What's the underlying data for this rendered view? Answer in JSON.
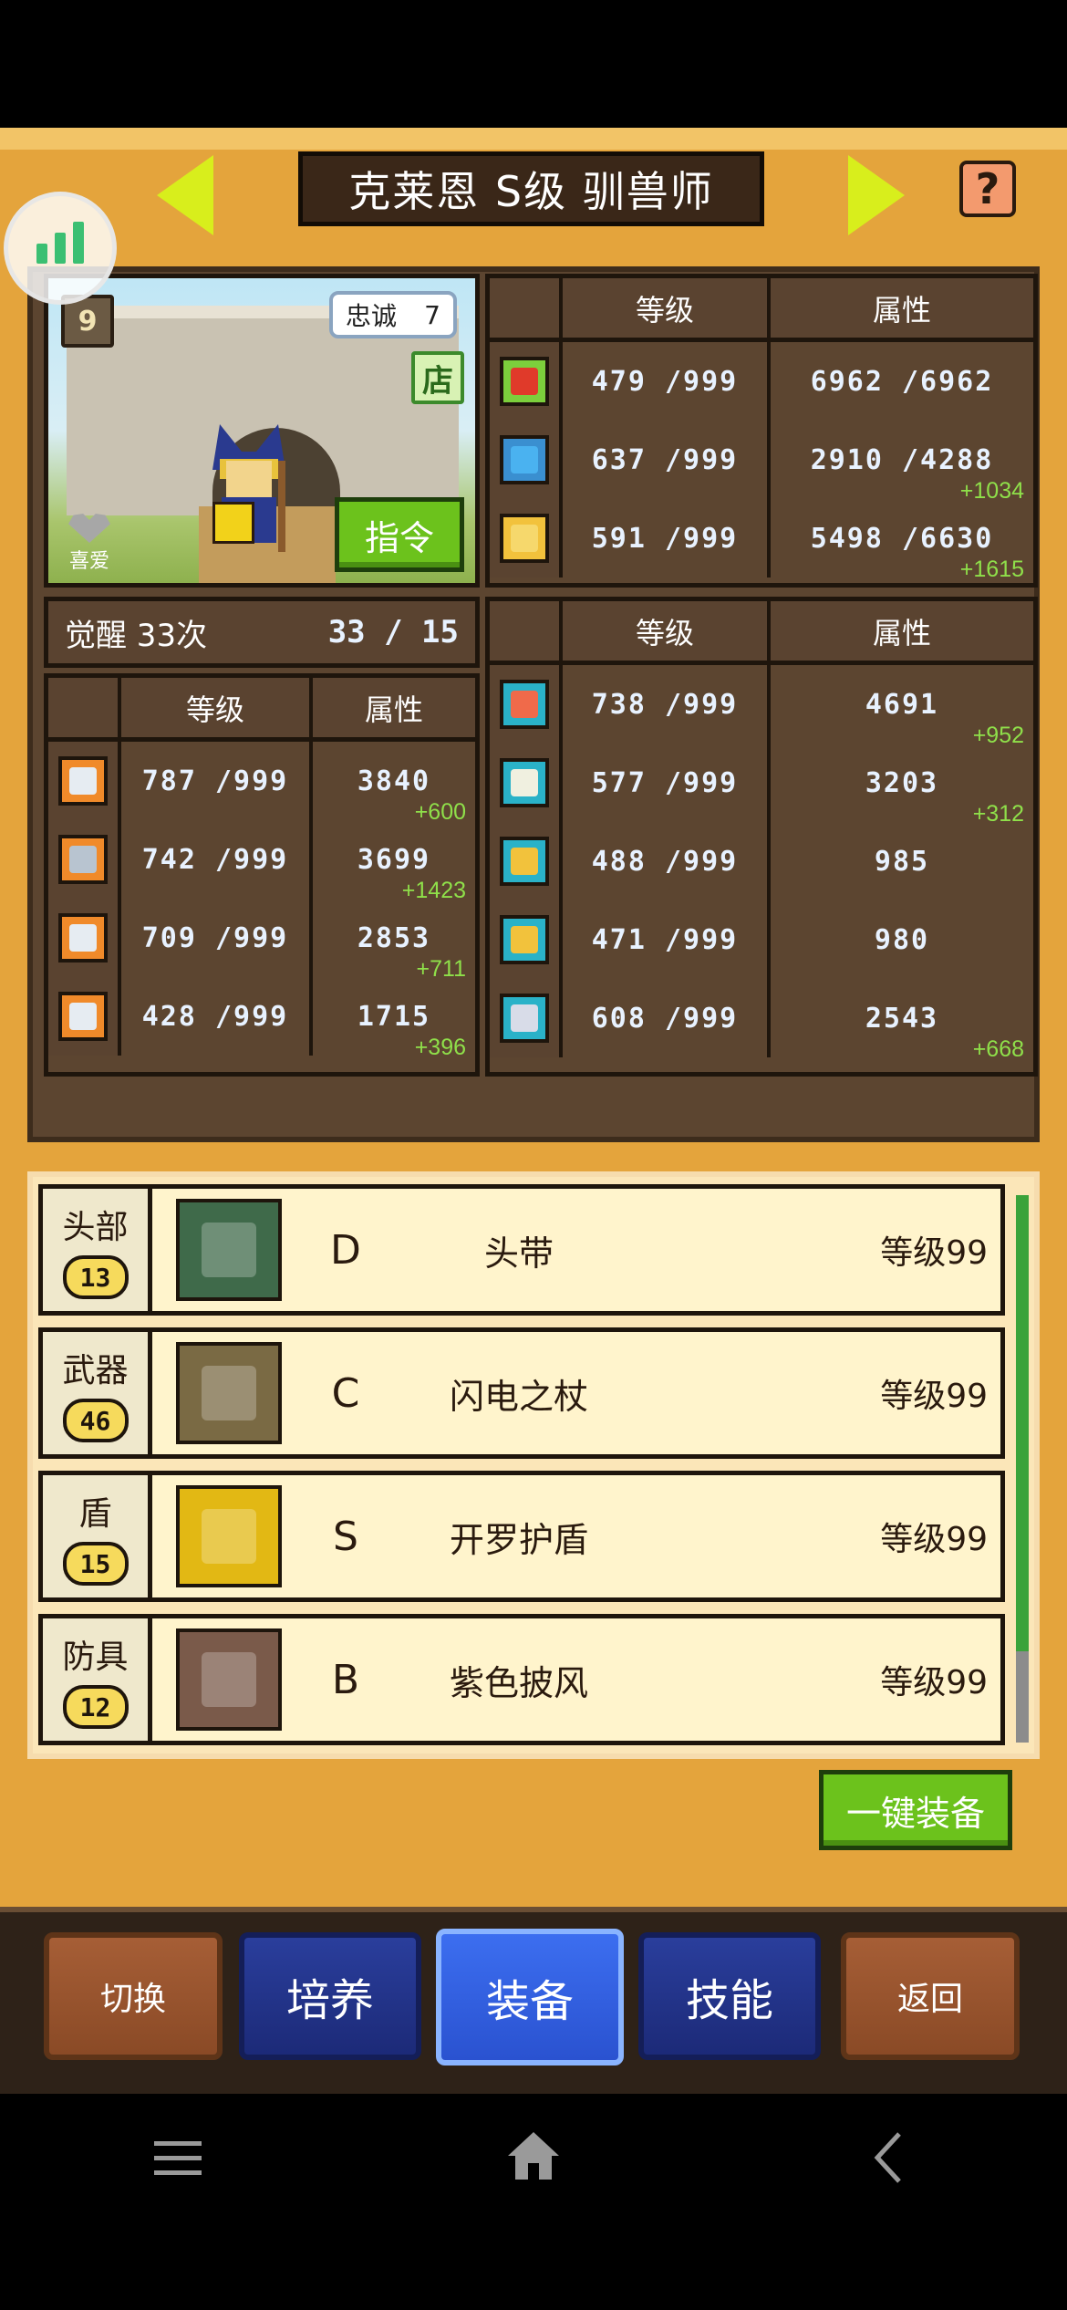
{
  "header": {
    "title": "克莱恩 S级 驯兽师",
    "help_label": "?"
  },
  "character": {
    "book_label": "9",
    "loyalty_label": "忠诚",
    "loyalty_value": "7",
    "shop_label": "店",
    "command_label": "指令",
    "like_label": "喜爱"
  },
  "vitals": {
    "col_level": "等级",
    "col_attr": "属性",
    "rows": [
      {
        "icon": "heart-icon",
        "level": "479 /999",
        "attr": "6962 /6962",
        "bonus": ""
      },
      {
        "icon": "potion-icon",
        "level": "637 /999",
        "attr": "2910 /4288",
        "bonus": "+1034"
      },
      {
        "icon": "muscle-icon",
        "level": "591 /999",
        "attr": "5498 /6630",
        "bonus": "+1615"
      }
    ]
  },
  "awaken": {
    "label": "觉醒 33次",
    "value": "33 /  15"
  },
  "combat": {
    "col_level": "等级",
    "col_attr": "属性",
    "rows": [
      {
        "icon": "sword-icon",
        "level": "787 /999",
        "attr": "3840",
        "bonus": "+600"
      },
      {
        "icon": "shield-icon",
        "level": "742 /999",
        "attr": "3699",
        "bonus": "+1423"
      },
      {
        "icon": "speed-icon",
        "level": "709 /999",
        "attr": "2853",
        "bonus": "+711"
      },
      {
        "icon": "star-icon",
        "level": "428 /999",
        "attr": "1715",
        "bonus": "+396"
      }
    ]
  },
  "skills": {
    "col_level": "等级",
    "col_attr": "属性",
    "rows": [
      {
        "icon": "book-icon",
        "level": "738 /999",
        "attr": "4691",
        "bonus": "+952"
      },
      {
        "icon": "pickaxe-icon",
        "level": "577 /999",
        "attr": "3203",
        "bonus": "+312"
      },
      {
        "icon": "shovel-icon",
        "level": "488 /999",
        "attr": "985",
        "bonus": ""
      },
      {
        "icon": "anvil-icon",
        "level": "471 /999",
        "attr": "980",
        "bonus": ""
      },
      {
        "icon": "hammer-icon",
        "level": "608 /999",
        "attr": "2543",
        "bonus": "+668"
      }
    ]
  },
  "equipment": [
    {
      "slot": "头部",
      "slot_level": "13",
      "grade": "D",
      "name": "头带",
      "level": "等级99",
      "icon": "headband-icon",
      "color": "#3f6a4a"
    },
    {
      "slot": "武器",
      "slot_level": "46",
      "grade": "C",
      "name": "闪电之杖",
      "level": "等级99",
      "icon": "staff-icon",
      "color": "#7a6a44"
    },
    {
      "slot": "盾",
      "slot_level": "15",
      "grade": "S",
      "name": "开罗护盾",
      "level": "等级99",
      "icon": "cairo-shield-icon",
      "color": "#e2b814"
    },
    {
      "slot": "防具",
      "slot_level": "12",
      "grade": "B",
      "name": "紫色披风",
      "level": "等级99",
      "icon": "cloak-icon",
      "color": "#7a5a4a"
    }
  ],
  "auto_equip_label": "一键装备",
  "menu": {
    "switch": "切换",
    "train": "培养",
    "equip": "装备",
    "skill": "技能",
    "back": "返回"
  }
}
